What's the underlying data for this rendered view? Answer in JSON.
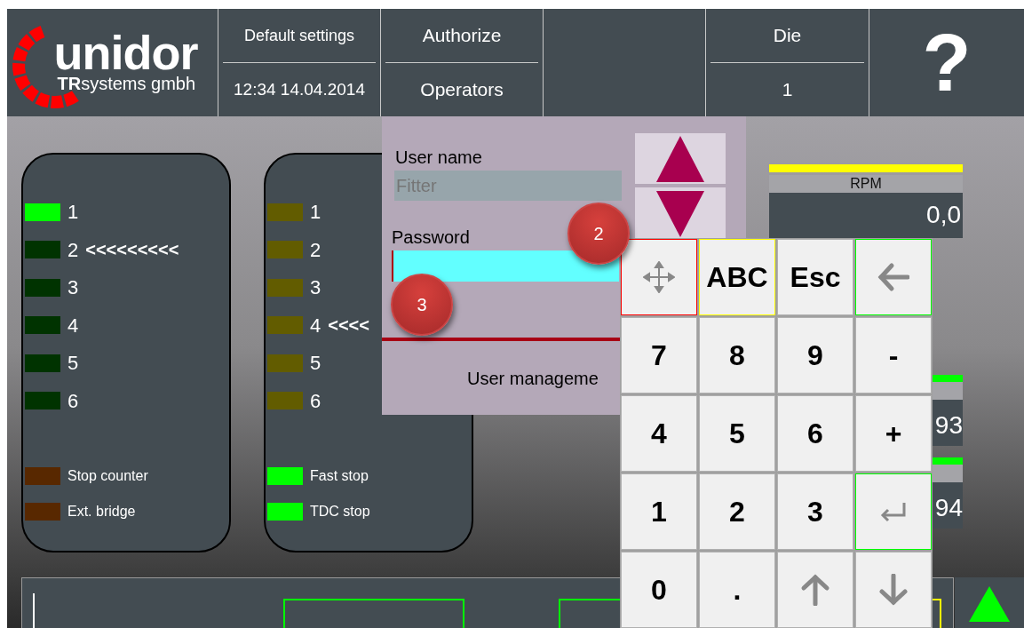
{
  "header": {
    "logo": {
      "name": "unidor",
      "tagline_bold": "TR",
      "tagline": "systems gmbh"
    },
    "settings": {
      "title": "Default settings",
      "datetime": "12:34 14.04.2014"
    },
    "authorize": {
      "label": "Authorize",
      "sub": "Operators"
    },
    "die": {
      "label": "Die",
      "value": "1"
    },
    "help": "?"
  },
  "panels": [
    {
      "leds": [
        {
          "label": "1",
          "color": "#00ff00"
        },
        {
          "label": "2",
          "color": "#003300",
          "marker": "<<<<<<<<<"
        },
        {
          "label": "3",
          "color": "#003300"
        },
        {
          "label": "4",
          "color": "#003300"
        },
        {
          "label": "5",
          "color": "#003300"
        },
        {
          "label": "6",
          "color": "#003300"
        }
      ],
      "signals": [
        {
          "label": "Stop counter",
          "color": "#582800"
        },
        {
          "label": "Ext. bridge",
          "color": "#582800"
        }
      ]
    },
    {
      "leds": [
        {
          "label": "1",
          "color": "#625c00"
        },
        {
          "label": "2",
          "color": "#625c00"
        },
        {
          "label": "3",
          "color": "#625c00"
        },
        {
          "label": "4",
          "color": "#625c00",
          "marker": "<<<<"
        },
        {
          "label": "5",
          "color": "#625c00"
        },
        {
          "label": "6",
          "color": "#625c00"
        }
      ],
      "signals": [
        {
          "label": "Fast stop",
          "color": "#00ff00"
        },
        {
          "label": "TDC stop",
          "color": "#00ff00"
        }
      ]
    }
  ],
  "rpm": {
    "label": "RPM",
    "value": "0,0"
  },
  "gauges": [
    {
      "value": "93"
    },
    {
      "value": "94"
    }
  ],
  "dialog": {
    "username": {
      "label": "User name",
      "placeholder": "Fitter"
    },
    "password": {
      "label": "Password"
    },
    "footer": "User manageme"
  },
  "keypad": [
    {
      "kind": "move",
      "color": "#ff0000"
    },
    {
      "kind": "text",
      "label": "ABC",
      "color": "#ffff00"
    },
    {
      "kind": "text",
      "label": "Esc"
    },
    {
      "kind": "back",
      "color": "#00ff00"
    },
    {
      "kind": "text",
      "label": "7"
    },
    {
      "kind": "text",
      "label": "8"
    },
    {
      "kind": "text",
      "label": "9"
    },
    {
      "kind": "text",
      "label": "-"
    },
    {
      "kind": "text",
      "label": "4"
    },
    {
      "kind": "text",
      "label": "5"
    },
    {
      "kind": "text",
      "label": "6"
    },
    {
      "kind": "text",
      "label": "+"
    },
    {
      "kind": "text",
      "label": "1"
    },
    {
      "kind": "text",
      "label": "2"
    },
    {
      "kind": "text",
      "label": "3"
    },
    {
      "kind": "enter",
      "color": "#00ff00"
    },
    {
      "kind": "text",
      "label": "0"
    },
    {
      "kind": "text",
      "label": "."
    },
    {
      "kind": "up"
    },
    {
      "kind": "down"
    }
  ],
  "badges": [
    {
      "label": "2"
    },
    {
      "label": "3"
    }
  ]
}
